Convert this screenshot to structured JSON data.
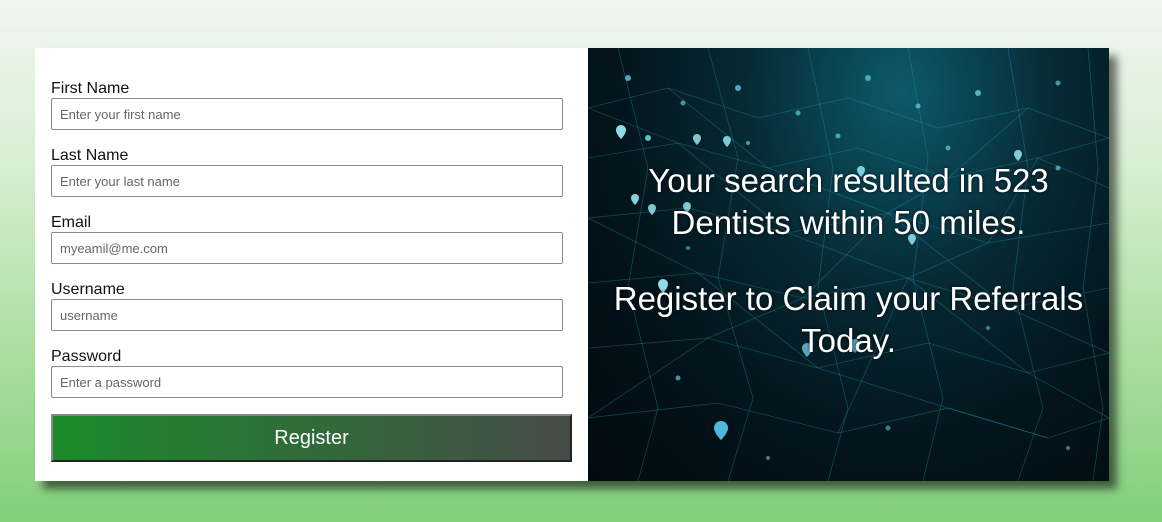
{
  "form": {
    "fields": [
      {
        "label": "First Name",
        "placeholder": "Enter your first name"
      },
      {
        "label": "Last Name",
        "placeholder": "Enter your last name"
      },
      {
        "label": "Email",
        "placeholder": "myeamil@me.com"
      },
      {
        "label": "Username",
        "placeholder": "username"
      },
      {
        "label": "Password",
        "placeholder": "Enter a password"
      }
    ],
    "register_label": "Register"
  },
  "hero": {
    "line1": "Your search resulted in 523 Dentists within 50 miles.",
    "line2": "Register to Claim your Referrals Today."
  },
  "colors": {
    "button_start": "#1b8b2a",
    "button_end": "#474b47",
    "background_bottom": "#82cf7c"
  }
}
